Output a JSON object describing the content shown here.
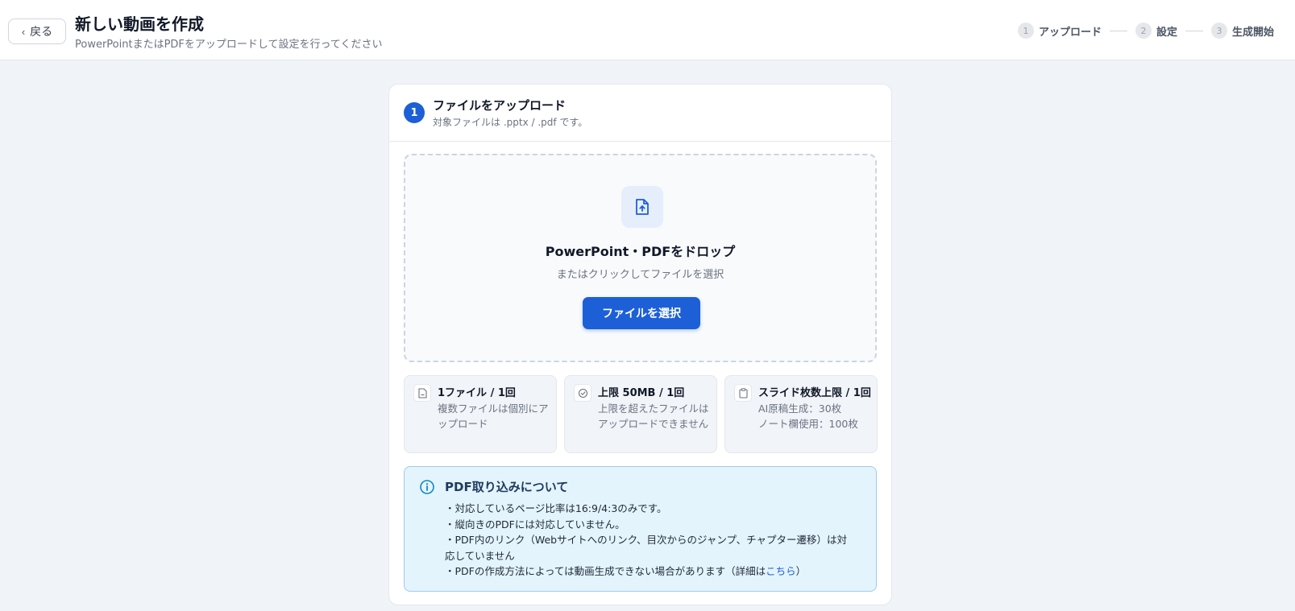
{
  "header": {
    "back_label": "戻る",
    "title": "新しい動画を作成",
    "subtitle": "PowerPointまたはPDFをアップロードして設定を行ってください",
    "steps": [
      {
        "num": "1",
        "label": "アップロード"
      },
      {
        "num": "2",
        "label": "設定"
      },
      {
        "num": "3",
        "label": "生成開始"
      }
    ]
  },
  "card": {
    "step_num": "1",
    "title": "ファイルをアップロード",
    "subtitle": "対象ファイルは .pptx / .pdf です。",
    "dropzone": {
      "icon": "file-upload-icon",
      "title": "PowerPoint・PDFをドロップ",
      "subtitle": "またはクリックしてファイルを選択",
      "button_label": "ファイルを選択"
    },
    "limits": [
      {
        "icon": "file-icon",
        "title": "1ファイル / 1回",
        "desc": "複数ファイルは個別にアップロード"
      },
      {
        "icon": "check-circle-icon",
        "title": "上限 50MB / 1回",
        "desc": "上限を超えたファイルはアップロードできません"
      },
      {
        "icon": "clipboard-icon",
        "title": "スライド枚数上限 / 1回",
        "desc_lines": [
          "AI原稿生成：30枚",
          "ノート欄使用：100枚"
        ]
      }
    ],
    "notice": {
      "icon": "info-icon",
      "title": "PDF取り込みについて",
      "items": [
        "・対応しているページ比率は16:9/4:3のみです。",
        "・縦向きのPDFには対応していません。",
        "・PDF内のリンク（Webサイトへのリンク、目次からのジャンプ、チャプター遷移）は対応していません"
      ],
      "last_item_prefix": "・PDFの作成方法によっては動画生成できない場合があります（詳細は",
      "last_item_link": "こちら",
      "last_item_suffix": "）"
    }
  },
  "colors": {
    "primary": "#1d5fd6",
    "background": "#f0f3f8",
    "notice_bg": "#e3f4fc"
  }
}
